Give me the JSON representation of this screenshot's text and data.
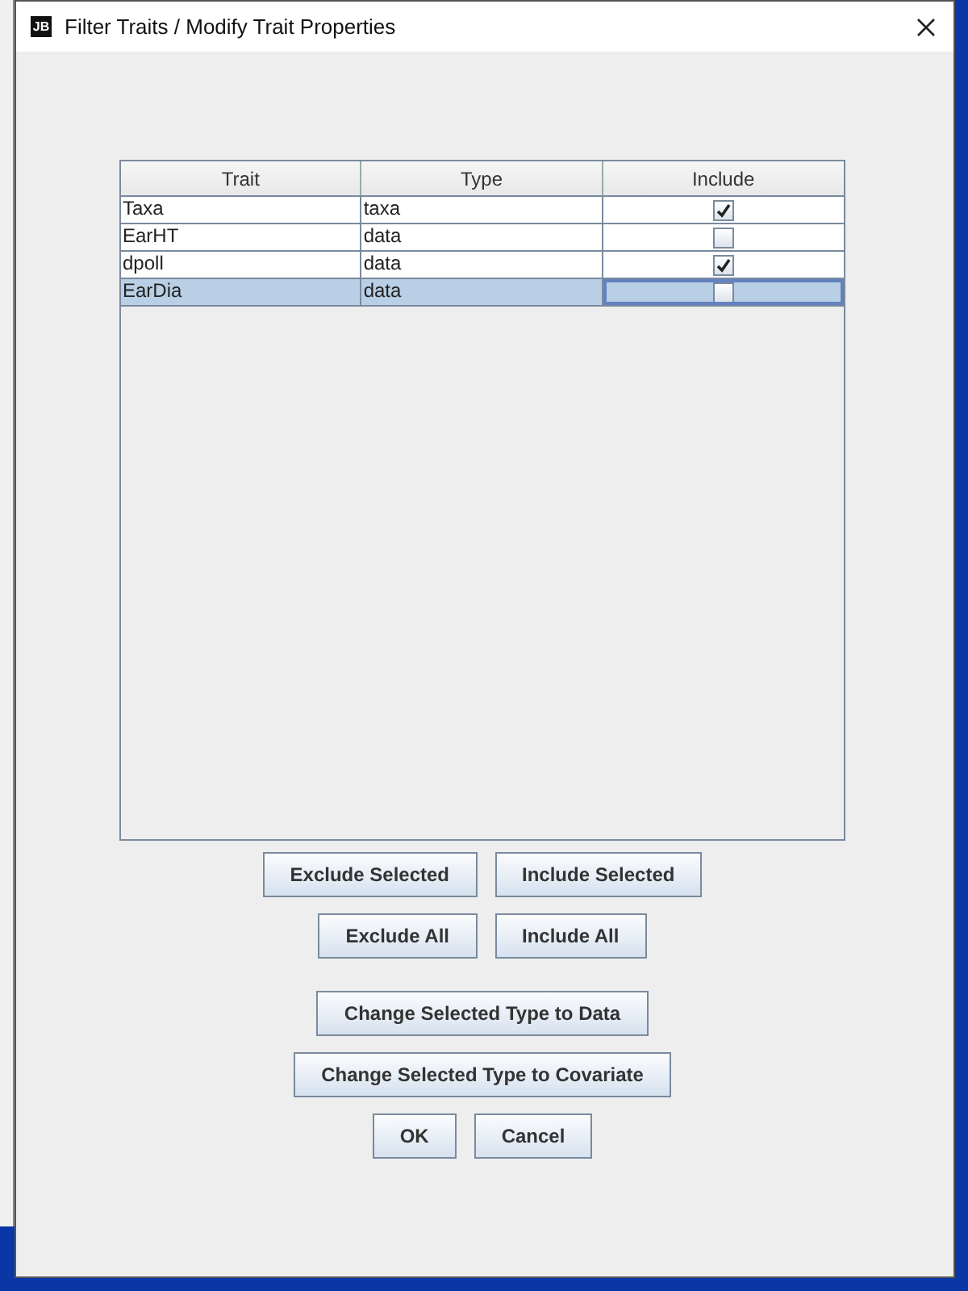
{
  "window": {
    "title": "Filter Traits / Modify Trait Properties",
    "app_icon": "JB"
  },
  "table": {
    "columns": [
      "Trait",
      "Type",
      "Include"
    ],
    "rows": [
      {
        "trait": "Taxa",
        "type": "taxa",
        "include": true,
        "selected": false
      },
      {
        "trait": "EarHT",
        "type": "data",
        "include": false,
        "selected": false
      },
      {
        "trait": "dpoll",
        "type": "data",
        "include": true,
        "selected": false
      },
      {
        "trait": "EarDia",
        "type": "data",
        "include": false,
        "selected": true
      }
    ]
  },
  "button_rows": [
    [
      "Exclude Selected",
      "Include Selected"
    ],
    [
      "Exclude All",
      "Include All"
    ],
    [
      "Change Selected Type to Data"
    ],
    [
      "Change Selected Type to Covariate"
    ],
    [
      "OK",
      "Cancel"
    ]
  ]
}
